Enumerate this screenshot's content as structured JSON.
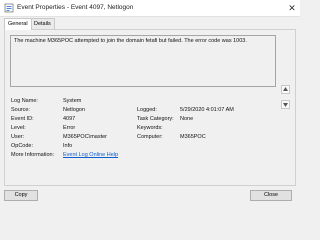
{
  "window": {
    "title": "Event Properties - Event 4097, Netlogon"
  },
  "tabs": [
    {
      "label": "General"
    },
    {
      "label": "Details"
    }
  ],
  "description": "The machine M365POC attempted to join the domain fetafi but failed. The error code was 1003.",
  "fields": {
    "log_name": {
      "label": "Log Name:",
      "value": "System"
    },
    "source": {
      "label": "Source:",
      "value": "Netlogon"
    },
    "event_id": {
      "label": "Event ID:",
      "value": "4097"
    },
    "level": {
      "label": "Level:",
      "value": "Error"
    },
    "user": {
      "label": "User:",
      "value": "M365POC\\master"
    },
    "opcode": {
      "label": "OpCode:",
      "value": "Info"
    },
    "more_info": {
      "label": "More Information:",
      "value": "Event Log Online Help"
    },
    "logged": {
      "label": "Logged:",
      "value": "5/29/2020 4:01:07 AM"
    },
    "task_category": {
      "label": "Task Category:",
      "value": "None"
    },
    "keywords": {
      "label": "Keywords:",
      "value": ""
    },
    "computer": {
      "label": "Computer:",
      "value": "M365POC"
    }
  },
  "buttons": {
    "copy": "Copy",
    "close": "Close"
  },
  "icons": {
    "app": "event-viewer-icon",
    "close": "close-icon",
    "up": "arrow-up-icon",
    "down": "arrow-down-icon"
  },
  "colors": {
    "link": "#0b5ecf"
  }
}
